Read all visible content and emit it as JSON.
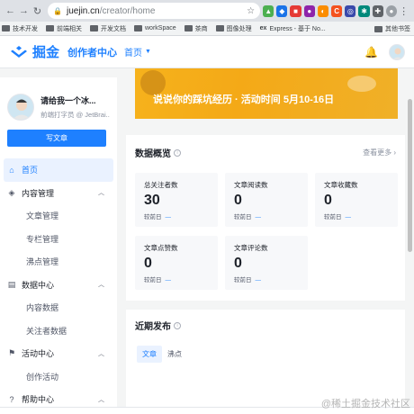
{
  "browser": {
    "url_host": "juejin.cn",
    "url_path": "/creator/home",
    "bookmarks": [
      "技术开发",
      "前端相关",
      "开发文档",
      "workSpace",
      "茶商",
      "图像处理",
      "Express - 基于 No..."
    ],
    "bookmark_other": "其他书签",
    "ext_colors": [
      "#4caf50",
      "#1a73e8",
      "#e53935",
      "#8e24aa",
      "#fb8c00",
      "#f4511e",
      "#3949ab",
      "#00897b"
    ]
  },
  "header": {
    "logo_text": "掘金",
    "creator_title": "创作者中心",
    "home_link": "首页"
  },
  "profile": {
    "name": "请给我一个冰...",
    "subtitle": "前端打字员 @ JetBrai..."
  },
  "sidebar": {
    "write_button": "写文章",
    "items": [
      {
        "label": "首页",
        "icon": "home-icon",
        "active": true
      },
      {
        "label": "内容管理",
        "icon": "layers-icon",
        "group": true
      },
      {
        "label": "文章管理",
        "sub": true
      },
      {
        "label": "专栏管理",
        "sub": true
      },
      {
        "label": "沸点管理",
        "sub": true
      },
      {
        "label": "数据中心",
        "icon": "chart-icon",
        "group": true
      },
      {
        "label": "内容数据",
        "sub": true
      },
      {
        "label": "关注者数据",
        "sub": true
      },
      {
        "label": "活动中心",
        "icon": "flag-icon",
        "group": true
      },
      {
        "label": "创作活动",
        "sub": true
      },
      {
        "label": "帮助中心",
        "icon": "help-icon",
        "group": true
      }
    ]
  },
  "banner": {
    "slogan": "说说你的踩坑经历 · 活动时间 5月10-16日"
  },
  "overview": {
    "title": "数据概览",
    "more": "查看更多 ›",
    "compare_label": "较前日",
    "compare_value": "—",
    "stats": [
      {
        "label": "总关注者数",
        "value": "30"
      },
      {
        "label": "文章阅读数",
        "value": "0"
      },
      {
        "label": "文章收藏数",
        "value": "0"
      },
      {
        "label": "文章点赞数",
        "value": "0"
      },
      {
        "label": "文章评论数",
        "value": "0"
      }
    ]
  },
  "recent": {
    "title": "近期发布",
    "tabs": [
      "文章",
      "沸点"
    ]
  },
  "watermark": "@稀土掘金技术社区"
}
